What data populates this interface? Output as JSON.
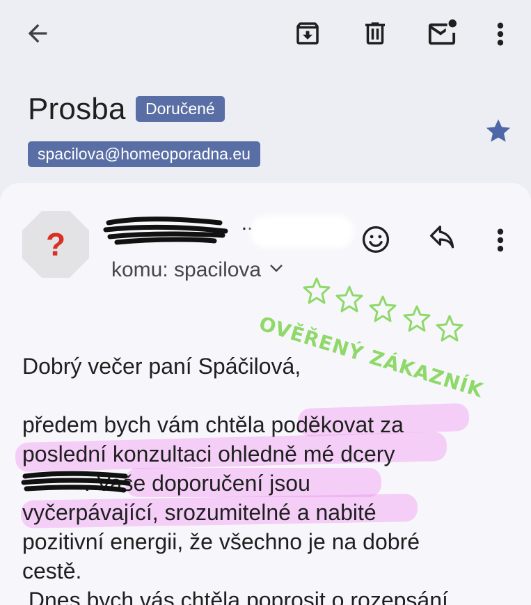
{
  "header": {
    "back_icon": "arrow-back-icon",
    "archive_icon": "archive-icon",
    "delete_icon": "trash-icon",
    "unread_icon": "mark-unread-icon",
    "more_icon": "more-vert-icon"
  },
  "message": {
    "subject": "Prosba",
    "label": "Doručené",
    "sender_email_chip": "spacilova@homeoporadna.eu",
    "starred": true,
    "star_color": "#4f67a8"
  },
  "sender": {
    "avatar_icon": "unknown-sender-question-icon",
    "name_partial": "..",
    "recipient_line": "komu: spacilova"
  },
  "actions": {
    "emoji_icon": "emoji-reaction-icon",
    "reply_icon": "reply-icon",
    "more_icon": "more-vert-icon"
  },
  "stamp": {
    "text": "OVĚŘENÝ ZÁKAZNÍK",
    "color": "#8fd86a",
    "star_count": 5
  },
  "body": {
    "greeting": "Dobrý večer paní Spáčilová,",
    "paragraph_lines": [
      "předem bych vám chtěla poděkovat za",
      "poslední konzultaci ohledně mé dcery",
      "          . Vaše doporučení jsou",
      "vyčerpávající, srozumitelné a nabité",
      "pozitivní energii, že všechno je na dobré",
      "cestě."
    ],
    "next_line": " Dnes bych vás chtěla poprosit o rozepsání"
  },
  "colors": {
    "background": "#eceef4",
    "card": "#f7f7fb",
    "chip": "#5a6ea6",
    "highlight": "#f078f0"
  }
}
